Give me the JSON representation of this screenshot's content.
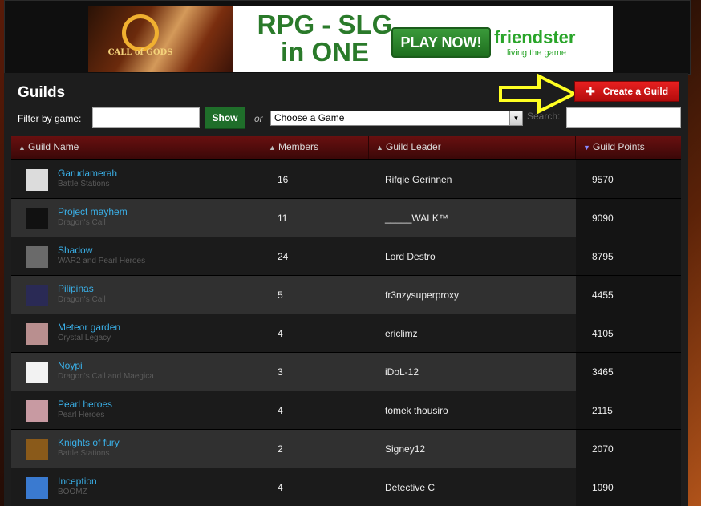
{
  "banner": {
    "logo_text": "CALL of GODS",
    "headline": "RPG - SLG in ONE",
    "cta": "PLAY NOW!",
    "brand": "friendster",
    "tagline": "living the game"
  },
  "header": {
    "title": "Guilds",
    "create_button": "Create a Guild",
    "filter_label": "Filter by game:",
    "filter_value": "",
    "show_button": "Show",
    "or_label": "or",
    "game_select": "Choose a Game",
    "search_label": "Search:",
    "search_value": ""
  },
  "colors": {
    "link": "#3ab0e8",
    "create_button": "#d01616",
    "show_button": "#1f6e2a",
    "header_row": "#5a0d0d",
    "arrow": "#ffff22"
  },
  "table": {
    "columns": [
      "Guild Name",
      "Members",
      "Guild Leader",
      "Guild Points"
    ],
    "sorted_column": "Guild Points",
    "rows": [
      {
        "name": "Garudamerah",
        "game": "Battle Stations",
        "members": "16",
        "leader": "Rifqie Gerinnen",
        "points": "9570",
        "thumb": "#dcdcdc"
      },
      {
        "name": "Project mayhem",
        "game": "Dragon's Call",
        "members": "11",
        "leader": "_____WALK™",
        "points": "9090",
        "thumb": "#111111"
      },
      {
        "name": "Shadow",
        "game": "WAR2 and Pearl Heroes",
        "members": "24",
        "leader": "Lord Destro",
        "points": "8795",
        "thumb": "#6a6a6a"
      },
      {
        "name": "Pilipinas",
        "game": "Dragon's Call",
        "members": "5",
        "leader": "fr3nzysuperproxy",
        "points": "4455",
        "thumb": "#2a2a55"
      },
      {
        "name": "Meteor garden",
        "game": "Crystal Legacy",
        "members": "4",
        "leader": "ericlimz",
        "points": "4105",
        "thumb": "#b98f8f"
      },
      {
        "name": "Noypi",
        "game": "Dragon's Call and Maegica",
        "members": "3",
        "leader": "iDoL-12",
        "points": "3465",
        "thumb": "#f2f2f2"
      },
      {
        "name": "Pearl heroes",
        "game": "Pearl Heroes",
        "members": "4",
        "leader": "tomek thousiro",
        "points": "2115",
        "thumb": "#c89aa2"
      },
      {
        "name": "Knights of fury",
        "game": "Battle Stations",
        "members": "2",
        "leader": "Signey12",
        "points": "2070",
        "thumb": "#8a5a1a"
      },
      {
        "name": "Inception",
        "game": "BOOMZ",
        "members": "4",
        "leader": "Detective C",
        "points": "1090",
        "thumb": "#3a7ad0"
      }
    ]
  }
}
